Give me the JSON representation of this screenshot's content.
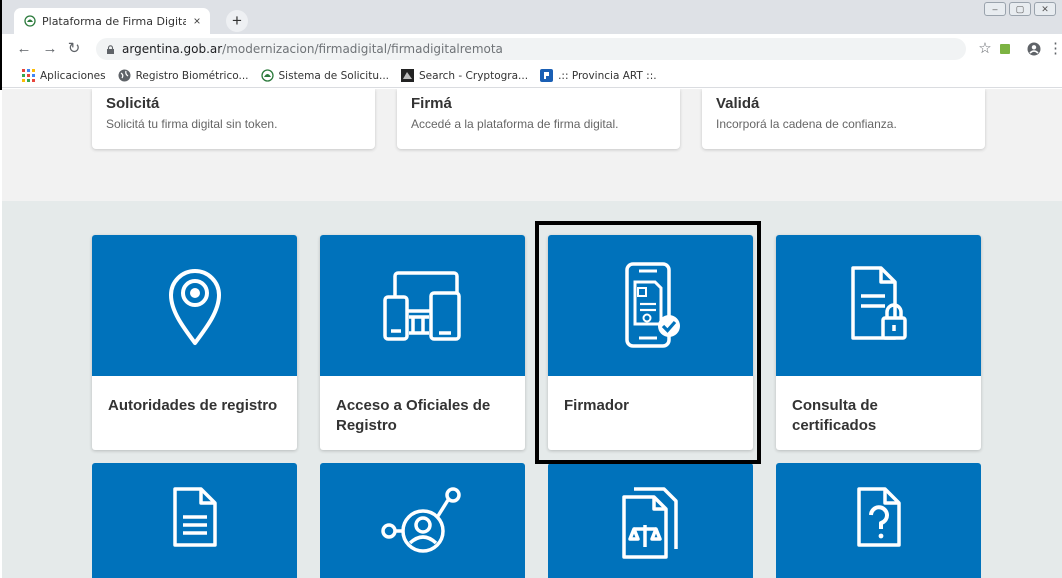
{
  "browser": {
    "tab_title": "Plataforma de Firma Digital Rem",
    "tab_close": "×",
    "new_tab": "+",
    "url_host": "argentina.gob.ar",
    "url_path": "/modernizacion/firmadigital/firmadigitalremota",
    "bookmarks": [
      {
        "label": "Aplicaciones",
        "icon": "apps-grid-icon",
        "color": "#e8453c"
      },
      {
        "label": "Registro Biométrico...",
        "icon": "globe-icon",
        "color": "#5f6368"
      },
      {
        "label": "Sistema de Solicitu...",
        "icon": "argentina-seal-icon",
        "color": "#2c7a3c"
      },
      {
        "label": "Search - Cryptogra...",
        "icon": "crypto-icon",
        "color": "#222222"
      },
      {
        "label": ".:: Provincia ART ::.",
        "icon": "provincia-icon",
        "color": "#1a5fb4"
      }
    ]
  },
  "top_cards": [
    {
      "title": "Solicitá",
      "subtitle": "Solicitá tu firma digital sin token."
    },
    {
      "title": "Firmá",
      "subtitle": "Accedé a la plataforma de firma digital."
    },
    {
      "title": "Validá",
      "subtitle": "Incorporá la cadena de confianza."
    }
  ],
  "tiles": [
    {
      "label": "Autoridades de registro",
      "icon": "location-pin-icon"
    },
    {
      "label": "Acceso a Oficiales de Registro",
      "icon": "devices-icon"
    },
    {
      "label": "Firmador",
      "icon": "mobile-signature-icon",
      "highlighted": true
    },
    {
      "label": "Consulta de certificados",
      "icon": "document-lock-icon"
    }
  ],
  "tiles_row2": [
    {
      "icon": "document-lines-icon"
    },
    {
      "icon": "user-network-icon"
    },
    {
      "icon": "legal-documents-icon"
    },
    {
      "icon": "question-document-icon"
    }
  ],
  "colors": {
    "accent": "#0072bb",
    "band": "#e5eaea"
  }
}
